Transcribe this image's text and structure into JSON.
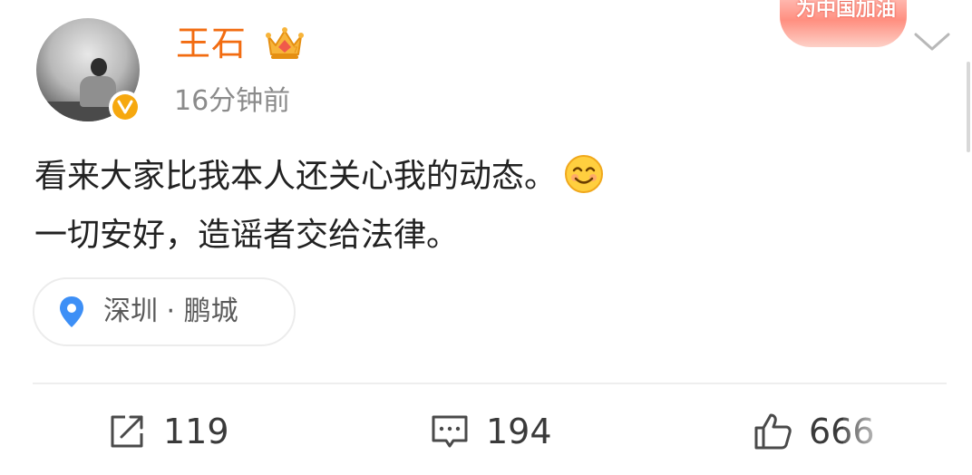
{
  "header": {
    "username": "王石",
    "post_time": "16分钟前",
    "banner_text": "为中国加油",
    "avatar_icon": "user-avatar",
    "verified_icon": "verified-v-badge",
    "crown_icon": "vip-crown-icon",
    "menu_icon": "chevron-down-icon"
  },
  "post": {
    "line1": "看来大家比我本人还关心我的动态。",
    "line2": "一切安好，造谣者交给法律。",
    "emoji_icon": "smile-emoji"
  },
  "location": {
    "icon": "location-pin-icon",
    "label": "深圳 · 鹏城"
  },
  "actions": {
    "repost": {
      "icon": "share-icon",
      "count": "119"
    },
    "comment": {
      "icon": "comment-icon",
      "count": "194"
    },
    "like": {
      "icon": "thumbs-up-icon",
      "count": "666"
    }
  },
  "colors": {
    "username": "#f26c11",
    "verified": "#f6a80f",
    "pin": "#3d8ff6",
    "muted_text": "#8b8b8b",
    "body_text": "#222222"
  }
}
